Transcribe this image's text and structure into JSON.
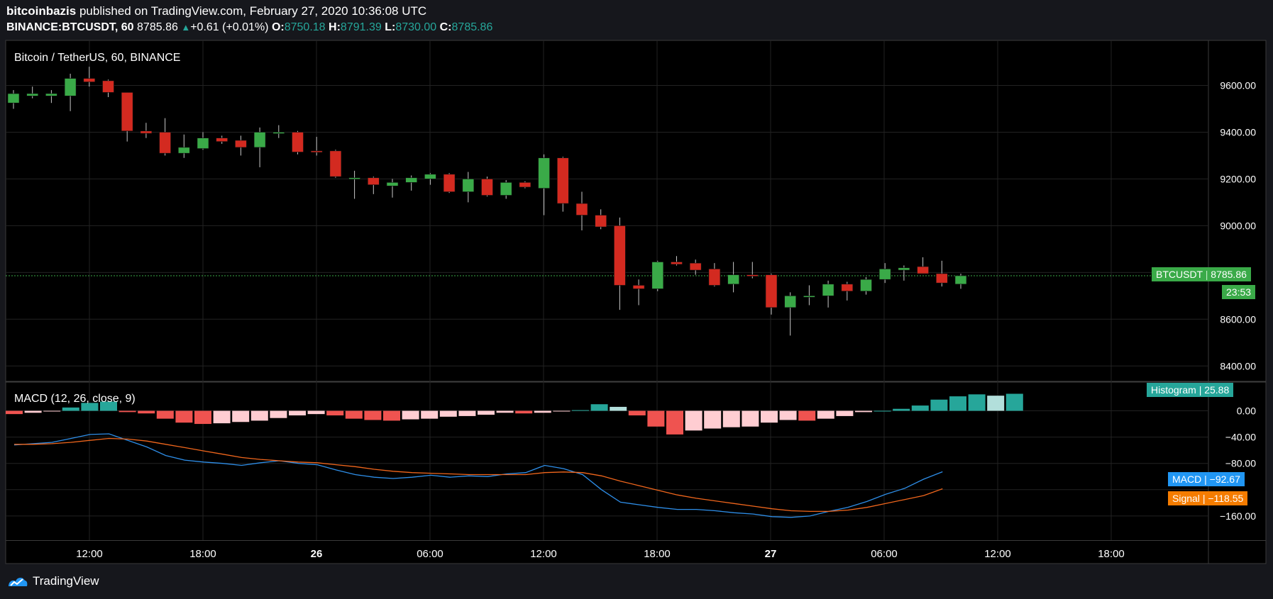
{
  "header": {
    "author": "bitcoinbazis",
    "published_text": "published on TradingView.com, February 27, 2020 10:36:08 UTC",
    "symbol_line": "BINANCE:BTCUSDT, 60",
    "last": "8785.86",
    "change": "+0.61 (+0.01%)",
    "o_label": "O:",
    "o_value": "8750.18",
    "h_label": "H:",
    "h_value": "8791.39",
    "l_label": "L:",
    "l_value": "8730.00",
    "c_label": "C:",
    "c_value": "8785.86"
  },
  "price_pane": {
    "title": "Bitcoin / TetherUS, 60, BINANCE",
    "ticker_tag": "BTCUSDT",
    "ticker_value": "8785.86",
    "countdown": "23:53"
  },
  "macd_pane": {
    "title": "MACD (12, 26, close, 9)",
    "histogram_label": "Histogram",
    "histogram_value": "25.88",
    "macd_label": "MACD",
    "macd_value": "−92.67",
    "signal_label": "Signal",
    "signal_value": "−118.55"
  },
  "footer": {
    "brand": "TradingView"
  },
  "colors": {
    "up": "#3aaa48",
    "down": "#d32a20",
    "macd": "#2e8ee8",
    "signal": "#f0661c",
    "hist_up_strong": "#26a69a",
    "hist_up_weak": "#b2dfdb",
    "hist_down_strong": "#ef5350",
    "hist_down_weak": "#ffcdd2",
    "price_tag": "#3aaa48",
    "pane_bg": "#000000"
  },
  "chart_data": [
    {
      "type": "candlestick",
      "title": "Bitcoin / TetherUS, 60, BINANCE",
      "y_ticks": [
        "9600.00",
        "9400.00",
        "9200.00",
        "9000.00",
        "8600.00",
        "8400.00"
      ],
      "x_ticks": [
        "12:00",
        "18:00",
        "26",
        "06:00",
        "12:00",
        "18:00",
        "27",
        "06:00",
        "12:00",
        "18:00"
      ],
      "ylim": [
        8330,
        9800
      ],
      "last_price": 8785.86,
      "candles": [
        {
          "o": 9525,
          "h": 9580,
          "l": 9500,
          "c": 9565
        },
        {
          "o": 9555,
          "h": 9595,
          "l": 9545,
          "c": 9565
        },
        {
          "o": 9555,
          "h": 9580,
          "l": 9525,
          "c": 9565
        },
        {
          "o": 9555,
          "h": 9650,
          "l": 9490,
          "c": 9630
        },
        {
          "o": 9630,
          "h": 9680,
          "l": 9595,
          "c": 9615
        },
        {
          "o": 9620,
          "h": 9625,
          "l": 9550,
          "c": 9570
        },
        {
          "o": 9570,
          "h": 9570,
          "l": 9360,
          "c": 9405
        },
        {
          "o": 9405,
          "h": 9440,
          "l": 9375,
          "c": 9395
        },
        {
          "o": 9400,
          "h": 9460,
          "l": 9300,
          "c": 9310
        },
        {
          "o": 9310,
          "h": 9390,
          "l": 9290,
          "c": 9335
        },
        {
          "o": 9330,
          "h": 9400,
          "l": 9325,
          "c": 9375
        },
        {
          "o": 9375,
          "h": 9385,
          "l": 9350,
          "c": 9360
        },
        {
          "o": 9365,
          "h": 9385,
          "l": 9300,
          "c": 9335
        },
        {
          "o": 9335,
          "h": 9420,
          "l": 9250,
          "c": 9400
        },
        {
          "o": 9395,
          "h": 9430,
          "l": 9375,
          "c": 9400
        },
        {
          "o": 9400,
          "h": 9405,
          "l": 9305,
          "c": 9315
        },
        {
          "o": 9320,
          "h": 9380,
          "l": 9300,
          "c": 9315
        },
        {
          "o": 9320,
          "h": 9325,
          "l": 9205,
          "c": 9210
        },
        {
          "o": 9205,
          "h": 9235,
          "l": 9115,
          "c": 9205
        },
        {
          "o": 9205,
          "h": 9210,
          "l": 9135,
          "c": 9175
        },
        {
          "o": 9170,
          "h": 9200,
          "l": 9120,
          "c": 9185
        },
        {
          "o": 9185,
          "h": 9215,
          "l": 9150,
          "c": 9205
        },
        {
          "o": 9200,
          "h": 9225,
          "l": 9175,
          "c": 9220
        },
        {
          "o": 9220,
          "h": 9225,
          "l": 9140,
          "c": 9145
        },
        {
          "o": 9145,
          "h": 9230,
          "l": 9100,
          "c": 9200
        },
        {
          "o": 9200,
          "h": 9210,
          "l": 9125,
          "c": 9130
        },
        {
          "o": 9130,
          "h": 9195,
          "l": 9115,
          "c": 9185
        },
        {
          "o": 9185,
          "h": 9190,
          "l": 9160,
          "c": 9165
        },
        {
          "o": 9160,
          "h": 9305,
          "l": 9045,
          "c": 9290
        },
        {
          "o": 9290,
          "h": 9295,
          "l": 9060,
          "c": 9095
        },
        {
          "o": 9095,
          "h": 9145,
          "l": 8980,
          "c": 9045
        },
        {
          "o": 9045,
          "h": 9070,
          "l": 8985,
          "c": 8995
        },
        {
          "o": 9000,
          "h": 9035,
          "l": 8640,
          "c": 8745
        },
        {
          "o": 8745,
          "h": 8770,
          "l": 8660,
          "c": 8730
        },
        {
          "o": 8730,
          "h": 8850,
          "l": 8720,
          "c": 8845
        },
        {
          "o": 8845,
          "h": 8870,
          "l": 8830,
          "c": 8835
        },
        {
          "o": 8840,
          "h": 8855,
          "l": 8790,
          "c": 8810
        },
        {
          "o": 8815,
          "h": 8840,
          "l": 8740,
          "c": 8745
        },
        {
          "o": 8750,
          "h": 8845,
          "l": 8715,
          "c": 8790
        },
        {
          "o": 8790,
          "h": 8845,
          "l": 8775,
          "c": 8785
        },
        {
          "o": 8790,
          "h": 8795,
          "l": 8620,
          "c": 8650
        },
        {
          "o": 8650,
          "h": 8715,
          "l": 8530,
          "c": 8700
        },
        {
          "o": 8695,
          "h": 8745,
          "l": 8660,
          "c": 8700
        },
        {
          "o": 8700,
          "h": 8765,
          "l": 8650,
          "c": 8750
        },
        {
          "o": 8750,
          "h": 8760,
          "l": 8680,
          "c": 8720
        },
        {
          "o": 8720,
          "h": 8780,
          "l": 8705,
          "c": 8770
        },
        {
          "o": 8770,
          "h": 8840,
          "l": 8755,
          "c": 8815
        },
        {
          "o": 8810,
          "h": 8830,
          "l": 8765,
          "c": 8820
        },
        {
          "o": 8825,
          "h": 8865,
          "l": 8800,
          "c": 8795
        },
        {
          "o": 8795,
          "h": 8850,
          "l": 8740,
          "c": 8755
        },
        {
          "o": 8750,
          "h": 8795,
          "l": 8730,
          "c": 8786
        }
      ]
    },
    {
      "type": "line",
      "title": "MACD (12, 26, close, 9)",
      "y_ticks": [
        "0.00",
        "−40.00",
        "−80.00",
        "−160.00"
      ],
      "ylim": [
        -168,
        30
      ],
      "histogram": [
        -5,
        -3,
        -1,
        5,
        12,
        14,
        -2,
        -4,
        -12,
        -18,
        -20,
        -19,
        -17,
        -15,
        -11,
        -7,
        -5,
        -7,
        -12,
        -14,
        -15,
        -13,
        -12,
        -9,
        -8,
        -6,
        -3,
        -4,
        -3,
        -1,
        1,
        10,
        6,
        -7,
        -24,
        -36,
        -30,
        -27,
        -25,
        -24,
        -18,
        -14,
        -15,
        -12,
        -8,
        -2,
        0,
        3,
        8,
        17,
        22,
        25,
        23,
        25.88
      ],
      "series": [
        {
          "name": "MACD",
          "values": [
            -52,
            -50,
            -48,
            -42,
            -36,
            -35,
            -45,
            -55,
            -68,
            -75,
            -78,
            -80,
            -83,
            -79,
            -76,
            -80,
            -82,
            -90,
            -97,
            -101,
            -103,
            -101,
            -98,
            -101,
            -99,
            -100,
            -96,
            -94,
            -83,
            -88,
            -97,
            -120,
            -139,
            -143,
            -147,
            -150,
            -150,
            -152,
            -155,
            -157,
            -161,
            -162,
            -160,
            -153,
            -147,
            -138,
            -127,
            -118,
            -104,
            -92.67
          ]
        },
        {
          "name": "Signal",
          "values": [
            -51,
            -51,
            -50,
            -48,
            -45,
            -42,
            -43,
            -46,
            -51,
            -56,
            -61,
            -66,
            -71,
            -74,
            -76,
            -78,
            -79,
            -82,
            -85,
            -89,
            -92,
            -94,
            -95,
            -96,
            -97,
            -97,
            -97,
            -97,
            -94,
            -93,
            -94,
            -99,
            -107,
            -114,
            -121,
            -128,
            -133,
            -137,
            -141,
            -145,
            -149,
            -152,
            -153,
            -153,
            -151,
            -147,
            -141,
            -135,
            -129,
            -118.55
          ]
        }
      ]
    }
  ]
}
